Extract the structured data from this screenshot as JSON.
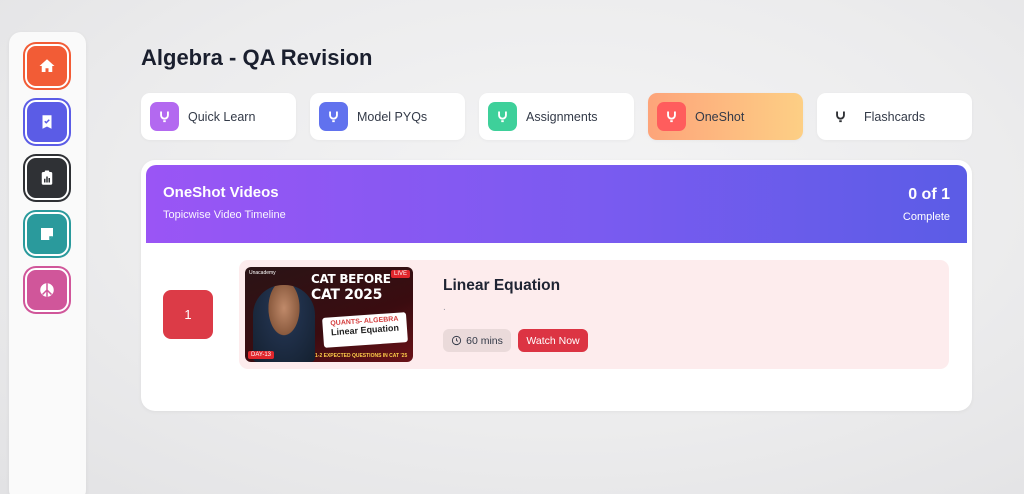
{
  "sidebar": {
    "items": [
      {
        "icon": "home-icon",
        "color": "#f25c36"
      },
      {
        "icon": "checklist-icon",
        "color": "#5b5ce6"
      },
      {
        "icon": "clipboard-chart-icon",
        "color": "#2f3135"
      },
      {
        "icon": "sticky-note-icon",
        "color": "#2a9a9c"
      },
      {
        "icon": "peace-icon",
        "color": "#d0569a"
      }
    ]
  },
  "page": {
    "title": "Algebra - QA Revision"
  },
  "tabs": [
    {
      "label": "Quick Learn",
      "color": "#b369f0"
    },
    {
      "label": "Model PYQs",
      "color": "#6172ee"
    },
    {
      "label": "Assignments",
      "color": "#3ed09a"
    },
    {
      "label": "OneShot",
      "color": "#ff5d5d",
      "active": true
    },
    {
      "label": "Flashcards",
      "color": "#2f3135"
    }
  ],
  "panel": {
    "title": "OneShot Videos",
    "subtitle": "Topicwise Video Timeline",
    "progress": "0 of 1",
    "progress_label": "Complete"
  },
  "videos": [
    {
      "index": "1",
      "title": "Linear Equation",
      "description": ".",
      "duration": "60 mins",
      "action_label": "Watch Now",
      "thumbnail": {
        "brand": "Unacademy",
        "headline_1": "CAT BEFORE",
        "headline_2": "CAT 2025",
        "card_top": "QUANTS- ALGEBRA",
        "card_main": "Linear Equation",
        "live": "LIVE",
        "day": "DAY-13",
        "strip": "1-2 EXPECTED QUESTIONS IN CAT '25"
      }
    }
  ]
}
